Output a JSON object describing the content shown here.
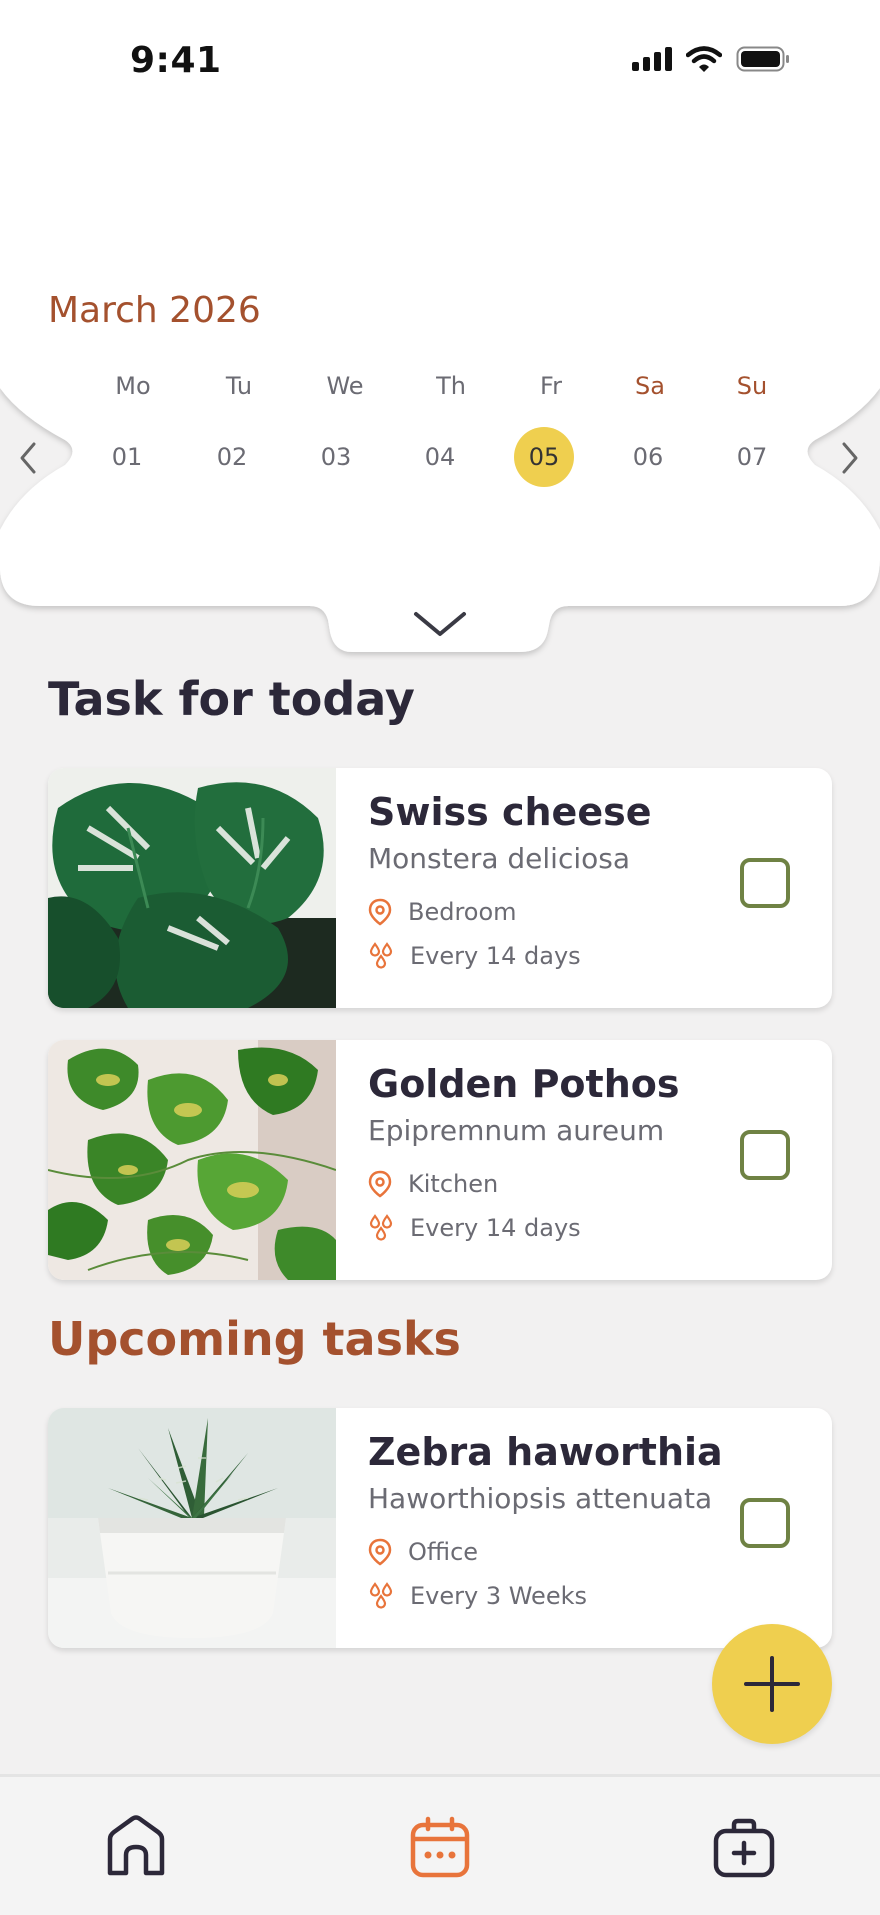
{
  "status": {
    "time": "9:41"
  },
  "calendar": {
    "month": "March 2026",
    "weekdays": [
      "Mo",
      "Tu",
      "We",
      "Th",
      "Fr",
      "Sa",
      "Su"
    ],
    "days": [
      "01",
      "02",
      "03",
      "04",
      "05",
      "06",
      "07"
    ],
    "selected_day": "05"
  },
  "today": {
    "title": "Task for today",
    "tasks": [
      {
        "name": "Swiss cheese",
        "scientific": "Monstera deliciosa",
        "location": "Bedroom",
        "frequency": "Every 14 days"
      },
      {
        "name": "Golden Pothos",
        "scientific": "Epipremnum aureum",
        "location": "Kitchen",
        "frequency": "Every 14 days"
      }
    ]
  },
  "upcoming": {
    "title": "Upcoming tasks",
    "tasks": [
      {
        "name": "Zebra haworthia",
        "scientific": "Haworthiopsis attenuata",
        "location": "Office",
        "frequency": "Every 3 Weeks"
      }
    ]
  },
  "colors": {
    "accent": "#a4512e",
    "highlight": "#efcf4f",
    "checkbox": "#6f8244",
    "text_dark": "#2c2839",
    "icon_orange": "#e8743b"
  },
  "icons": {
    "location": "location-pin-icon",
    "frequency": "water-drops-icon",
    "nav": [
      "home-icon",
      "calendar-icon",
      "medical-kit-icon"
    ],
    "fab": "plus-icon"
  }
}
